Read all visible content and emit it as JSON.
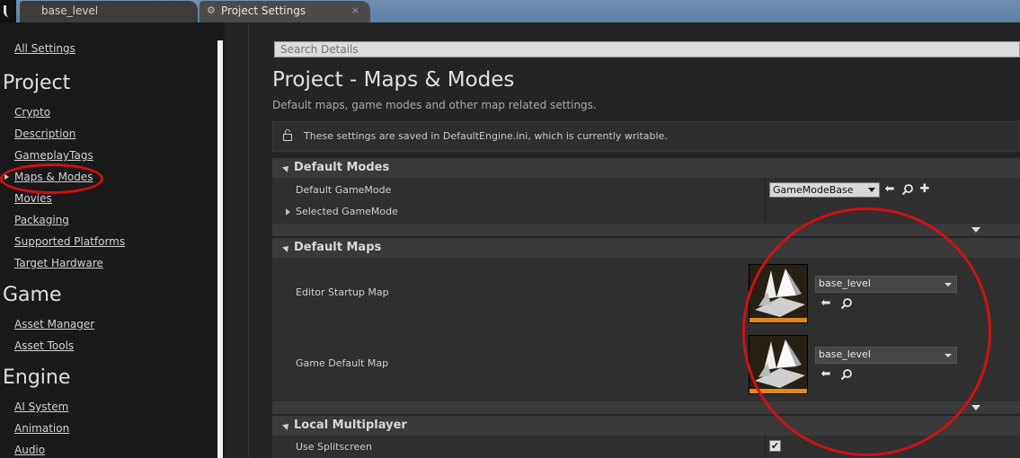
{
  "tabs": [
    {
      "label": "base_level"
    },
    {
      "label": "Project Settings",
      "close": "×"
    }
  ],
  "sidebar": {
    "all_settings": "All Settings",
    "sections": [
      {
        "heading": "Project",
        "items": [
          "Crypto",
          "Description",
          "GameplayTags",
          "Maps & Modes",
          "Movies",
          "Packaging",
          "Supported Platforms",
          "Target Hardware"
        ]
      },
      {
        "heading": "Game",
        "items": [
          "Asset Manager",
          "Asset Tools"
        ]
      },
      {
        "heading": "Engine",
        "items": [
          "AI System",
          "Animation",
          "Audio"
        ]
      }
    ],
    "selected": "Maps & Modes"
  },
  "search": {
    "placeholder": "Search Details"
  },
  "page": {
    "title": "Project - Maps & Modes",
    "description": "Default maps, game modes and other map related settings.",
    "notice": "These settings are saved in DefaultEngine.ini, which is currently writable."
  },
  "categories": {
    "default_modes": {
      "label": "Default Modes",
      "default_gamemode_label": "Default GameMode",
      "default_gamemode_value": "GameModeBase",
      "selected_gamemode_label": "Selected GameMode"
    },
    "default_maps": {
      "label": "Default Maps",
      "editor_startup_label": "Editor Startup Map",
      "editor_startup_value": "base_level",
      "game_default_label": "Game Default Map",
      "game_default_value": "base_level"
    },
    "local_multiplayer": {
      "label": "Local Multiplayer",
      "use_splitscreen_label": "Use Splitscreen",
      "use_splitscreen_checked": true
    }
  },
  "glyphs": {
    "check": "✔",
    "add": "✚"
  },
  "colors": {
    "annotation_red": "#d30f12",
    "thumbnail_accent": "#e08a16"
  }
}
